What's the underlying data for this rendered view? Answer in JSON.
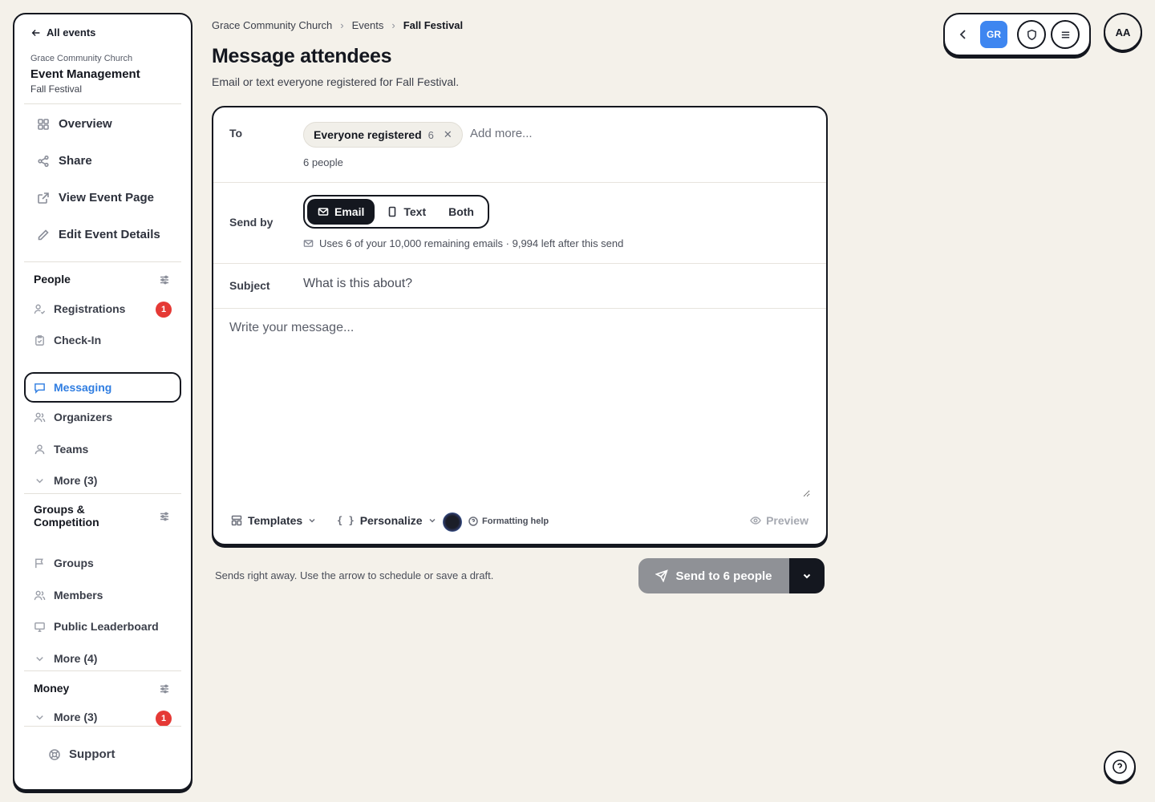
{
  "sidebar": {
    "back_label": "All events",
    "org": "Grace Community Church",
    "app_title": "Event Management",
    "event_name": "Fall Festival",
    "top_items": [
      {
        "label": "Overview",
        "icon": "grid-icon"
      },
      {
        "label": "Share",
        "icon": "share-icon"
      },
      {
        "label": "View Event Page",
        "icon": "external-link-icon"
      },
      {
        "label": "Edit Event Details",
        "icon": "pencil-icon"
      }
    ],
    "people": {
      "title": "People",
      "items": [
        {
          "label": "Registrations",
          "badge": "1",
          "icon": "user-check-icon"
        },
        {
          "label": "Check-In",
          "icon": "clipboard-check-icon"
        },
        {
          "label": "Messaging",
          "icon": "message-icon"
        },
        {
          "label": "Organizers",
          "icon": "users-icon"
        },
        {
          "label": "Teams",
          "icon": "user-icon"
        },
        {
          "label": "More (3)",
          "icon": "chevron-down-icon"
        }
      ]
    },
    "groups": {
      "title_line1": "Groups &",
      "title_line2": "Competition",
      "items": [
        {
          "label": "Groups",
          "icon": "flag-icon"
        },
        {
          "label": "Members",
          "icon": "users-icon"
        },
        {
          "label": "Public Leaderboard",
          "icon": "monitor-icon"
        },
        {
          "label": "More (4)",
          "icon": "chevron-down-icon"
        }
      ]
    },
    "money": {
      "title": "Money",
      "items": [
        {
          "label": "More (3)",
          "badge": "1",
          "icon": "chevron-down-icon"
        }
      ]
    },
    "support_label": "Support"
  },
  "breadcrumb": [
    "Grace Community Church",
    "Events",
    "Fall Festival"
  ],
  "page": {
    "title": "Message attendees",
    "description": "Email or text everyone registered for Fall Festival."
  },
  "form": {
    "to_label": "To",
    "chip_label": "Everyone registered",
    "chip_count": "6",
    "add_more_placeholder": "Add more...",
    "people_count": "6 people",
    "send_by_label": "Send by",
    "send_options": [
      "Email",
      "Text",
      "Both"
    ],
    "selected_send_option": "Email",
    "quota_text": "Uses 6 of your 10,000 remaining emails · 9,994 left after this send",
    "subject_label": "Subject",
    "subject_placeholder": "What is this about?",
    "message_placeholder": "Write your message...",
    "templates_label": "Templates",
    "personalize_label": "Personalize",
    "formatting_help_label": "Formatting help",
    "preview_label": "Preview"
  },
  "send": {
    "note": "Sends right away. Use the arrow to schedule or save a draft.",
    "button_label": "Send to 6 people"
  },
  "topbar": {
    "gr_label": "GR",
    "avatar_initials": "AA"
  },
  "colors": {
    "accent_blue": "#3e86f0",
    "badge_red": "#e53935",
    "background": "#f4f1ea",
    "ink": "#14171f"
  }
}
